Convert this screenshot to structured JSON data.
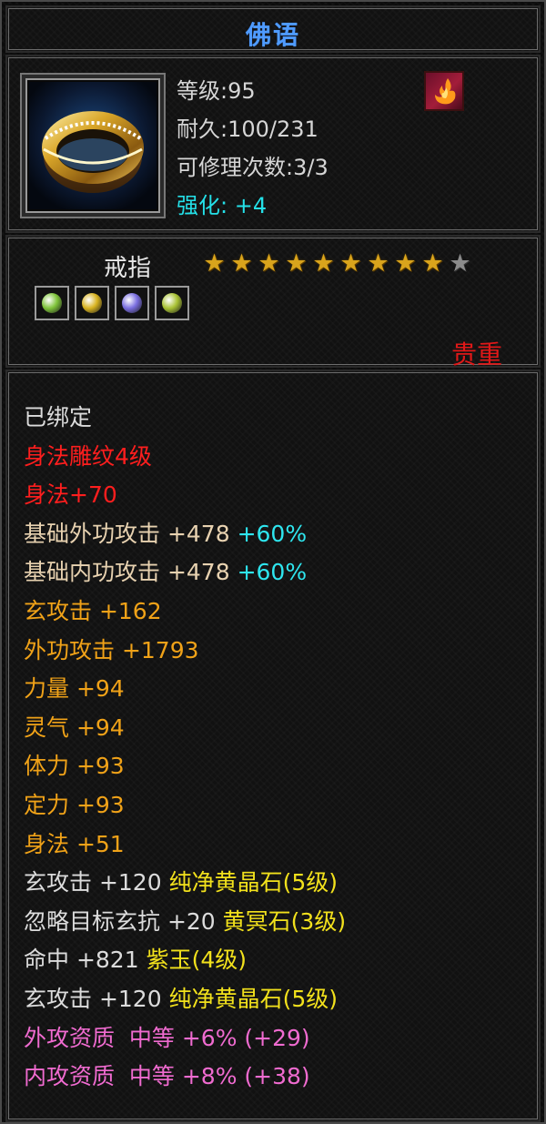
{
  "title": "佛语",
  "item": {
    "level": "等级:95",
    "durability": "耐久:100/231",
    "repairs": "可修理次数:3/3",
    "enhance_label": "强化:",
    "enhance_value": "+4",
    "type": "戒指",
    "stars_filled": 9,
    "stars_total": 10,
    "rarity": "贵重"
  },
  "gems": [
    {
      "name": "green-gem",
      "color": "#7fc43a"
    },
    {
      "name": "gold-gem",
      "color": "#d8b320"
    },
    {
      "name": "purple-gem",
      "color": "#7a6ee0"
    },
    {
      "name": "green-gold-gem",
      "color": "#a9c234"
    }
  ],
  "attributes": [
    {
      "text": "已绑定",
      "color": "#dcdcdc"
    },
    {
      "text": "身法雕纹4级",
      "color": "#ff1e1e"
    },
    {
      "text": "身法+70",
      "color": "#ff1e1e"
    },
    {
      "text": "基础外功攻击 +478",
      "extra": " +60%",
      "color": "#e8d2b0",
      "extra_color": "#2ee6ef"
    },
    {
      "text": "基础内功攻击 +478",
      "extra": " +60%",
      "color": "#e8d2b0",
      "extra_color": "#2ee6ef"
    },
    {
      "text": "玄攻击 +162",
      "color": "#f0a218"
    },
    {
      "text": "外功攻击 +1793",
      "color": "#f0a218"
    },
    {
      "text": "力量 +94",
      "color": "#f0a218"
    },
    {
      "text": "灵气 +94",
      "color": "#f0a218"
    },
    {
      "text": "体力 +93",
      "color": "#f0a218"
    },
    {
      "text": "定力 +93",
      "color": "#f0a218"
    },
    {
      "text": "身法 +51",
      "color": "#f0a218"
    },
    {
      "text": "玄攻击 +120",
      "extra": " 纯净黄晶石(5级)",
      "color": "#dcdcdc",
      "extra_color": "#f2e11c"
    },
    {
      "text": "忽略目标玄抗 +20",
      "extra": " 黄冥石(3级)",
      "color": "#dcdcdc",
      "extra_color": "#f2e11c"
    },
    {
      "text": "命中 +821",
      "extra": " 紫玉(4级)",
      "color": "#dcdcdc",
      "extra_color": "#f2e11c"
    },
    {
      "text": "玄攻击 +120",
      "extra": " 纯净黄晶石(5级)",
      "color": "#dcdcdc",
      "extra_color": "#f2e11c"
    },
    {
      "text": "外攻资质  中等 +6% (+29)",
      "color": "#f06bd0"
    },
    {
      "text": "内攻资质  中等 +8% (+38)",
      "color": "#f06bd0"
    }
  ]
}
